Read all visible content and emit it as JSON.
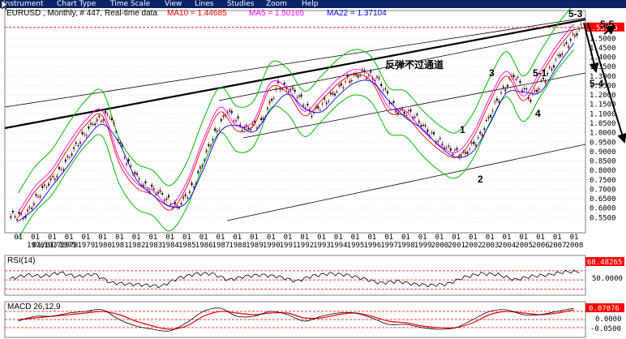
{
  "menubar": {
    "items": [
      "Instrument",
      "Chart Type",
      "Time Scale",
      "View",
      "Lines",
      "Studies",
      "Zoom",
      "Help"
    ]
  },
  "chart_header": {
    "symbol": "EURUSD , Monthly, # 447, Real-time data",
    "ma10": "MA10 = 1.44685",
    "ma5": "MA5 = 1.50165",
    "ma22": "MA22 = 1.37104"
  },
  "colors": {
    "ma10": "#ff0000",
    "ma5": "#ff00ff",
    "ma22": "#0000ff",
    "bollinger": "#00bb00",
    "candle_up": "#d00000",
    "channel": "#000000",
    "price_marker": "#ff0000",
    "menubar": "#0a246a"
  },
  "chart_data": [
    {
      "type": "candlestick",
      "name": "price",
      "ylim": [
        0.5,
        1.6
      ],
      "yticks": [
        0.55,
        0.6,
        0.65,
        0.7,
        0.75,
        0.8,
        0.85,
        0.9,
        0.95,
        1.0,
        1.05,
        1.1,
        1.15,
        1.2,
        1.25,
        1.3,
        1.35,
        1.4,
        1.45,
        1.5,
        1.55
      ],
      "ytick_labels": [
        "0.5500",
        "0.6000",
        "0.6500",
        "0.7000",
        "0.7500",
        "0.8000",
        "0.8500",
        "0.9000",
        "0.9500",
        "1.0000",
        "1.0500",
        "1.1000",
        "1.1500",
        "1.2000",
        "1.2500",
        "1.3000",
        "1.3500",
        "1.4000",
        "1.4500",
        "1.5000",
        "1.5500"
      ],
      "last_price": 1.5579,
      "last_price_label": "1.55795",
      "x_month_labels": [
        "01",
        "01",
        "01",
        "01",
        "01",
        "01",
        "01",
        "01",
        "01",
        "01",
        "01",
        "01",
        "01",
        "01",
        "01",
        "01",
        "01",
        "01",
        "01",
        "01",
        "01",
        "01",
        "01",
        "01",
        "01",
        "01",
        "01",
        "01",
        "01",
        "01",
        "01",
        "01",
        "01",
        "01",
        "01",
        "01",
        "01"
      ],
      "x_year_labels": [
        "01/01/1975",
        "1976",
        "1977",
        "1978",
        "1979",
        "1980",
        "1981",
        "1982",
        "1983",
        "1984",
        "1985",
        "1986",
        "1987",
        "1988",
        "1989",
        "1990",
        "1991",
        "1992",
        "1993",
        "1994",
        "1995",
        "1996",
        "1997",
        "1998",
        "1999",
        "2000",
        "2001",
        "2002",
        "2003",
        "2004",
        "2005",
        "2006",
        "2007",
        "2008"
      ],
      "x": [
        1975,
        1976,
        1977,
        1978,
        1979,
        1980,
        1981,
        1982,
        1983,
        1984,
        1985,
        1986,
        1987,
        1988,
        1989,
        1990,
        1991,
        1992,
        1993,
        1994,
        1995,
        1996,
        1997,
        1998,
        1999,
        2000,
        2001,
        2002,
        2003,
        2004,
        2005,
        2006,
        2007,
        2008
      ],
      "close": [
        0.56,
        0.7,
        0.79,
        0.93,
        1.05,
        1.1,
        0.85,
        0.72,
        0.68,
        0.6,
        0.72,
        0.95,
        1.12,
        1.02,
        1.05,
        1.25,
        1.22,
        1.1,
        1.18,
        1.27,
        1.32,
        1.28,
        1.12,
        1.1,
        1.0,
        0.92,
        0.88,
        0.98,
        1.17,
        1.31,
        1.18,
        1.31,
        1.45,
        1.56
      ],
      "annotations": {
        "label_cn": "反弹不过通道",
        "wave_1": "1",
        "wave_2": "2",
        "wave_3": "3",
        "wave_4": "4",
        "wave_5_1": "5-1",
        "wave_5_3": "5-3",
        "wave_5_4": "5-4",
        "wave_5_5": "5-5"
      }
    },
    {
      "type": "line",
      "name": "RSI",
      "title": "RSI(14)",
      "ylim": [
        20,
        100
      ],
      "levels": [
        30,
        50,
        70
      ],
      "last_value_label": "68.48265",
      "level_label": "50.0000",
      "values": [
        52,
        61,
        58,
        66,
        57,
        63,
        44,
        41,
        39,
        36,
        54,
        63,
        64,
        50,
        58,
        61,
        57,
        47,
        59,
        64,
        61,
        53,
        43,
        47,
        41,
        38,
        41,
        56,
        64,
        62,
        50,
        58,
        61,
        68
      ]
    },
    {
      "type": "line",
      "name": "MACD",
      "title": "MACD 26,12,9",
      "ylim": [
        -0.1,
        0.1
      ],
      "last_value_label": "0.07076",
      "zero_label": "0.0000",
      "neg_label": "-0.0500",
      "macd": [
        -0.01,
        0.02,
        0.02,
        0.04,
        0.05,
        0.06,
        0.0,
        -0.04,
        -0.06,
        -0.07,
        -0.02,
        0.05,
        0.07,
        0.02,
        0.02,
        0.05,
        0.03,
        -0.01,
        0.02,
        0.04,
        0.04,
        0.01,
        -0.03,
        -0.03,
        -0.05,
        -0.06,
        -0.05,
        0.0,
        0.05,
        0.06,
        0.03,
        0.03,
        0.05,
        0.07
      ],
      "signal": [
        0.0,
        0.01,
        0.02,
        0.03,
        0.04,
        0.05,
        0.03,
        -0.01,
        -0.04,
        -0.06,
        -0.04,
        0.02,
        0.05,
        0.04,
        0.03,
        0.04,
        0.04,
        0.01,
        0.01,
        0.03,
        0.04,
        0.02,
        -0.01,
        -0.02,
        -0.04,
        -0.05,
        -0.05,
        -0.02,
        0.03,
        0.05,
        0.04,
        0.03,
        0.04,
        0.06
      ]
    }
  ]
}
